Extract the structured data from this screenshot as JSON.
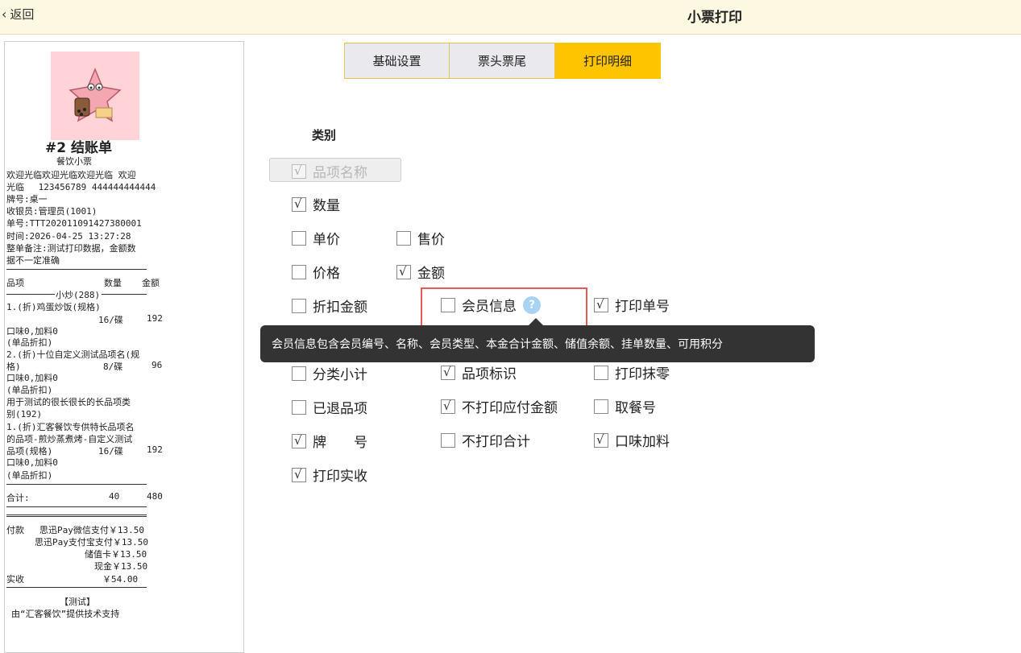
{
  "header": {
    "back_label": "返回",
    "title": "小票打印"
  },
  "tabs": [
    {
      "label": "基础设置",
      "active": false
    },
    {
      "label": "票头票尾",
      "active": false
    },
    {
      "label": "打印明细",
      "active": true
    }
  ],
  "category_label": "类别",
  "options": {
    "item_name": {
      "label": "品项名称",
      "checked": true,
      "disabled": true
    },
    "quantity": {
      "label": "数量",
      "checked": true
    },
    "unit_price": {
      "label": "单价",
      "checked": false
    },
    "sale_price": {
      "label": "售价",
      "checked": false
    },
    "price": {
      "label": "价格",
      "checked": false
    },
    "amount": {
      "label": "金额",
      "checked": true
    },
    "discount_amount": {
      "label": "折扣金额",
      "checked": false
    },
    "member_info": {
      "label": "会员信息",
      "checked": false
    },
    "print_order_no": {
      "label": "打印单号",
      "checked": true
    },
    "category_subtotal": {
      "label": "分类小计",
      "checked": false
    },
    "item_mark": {
      "label": "品项标识",
      "checked": true
    },
    "print_rounding": {
      "label": "打印抹零",
      "checked": false
    },
    "returned_items": {
      "label": "已退品项",
      "checked": false
    },
    "no_payable_amount": {
      "label": "不打印应付金额",
      "checked": true
    },
    "pickup_no": {
      "label": "取餐号",
      "checked": false
    },
    "table_no": {
      "label": "牌　　号",
      "checked": true
    },
    "no_total": {
      "label": "不打印合计",
      "checked": false
    },
    "flavor_addon": {
      "label": "口味加料",
      "checked": true
    },
    "print_received": {
      "label": "打印实收",
      "checked": true
    }
  },
  "tooltip": "会员信息包含会员编号、名称、会员类型、本金合计金额、储值余额、挂单数量、可用积分",
  "help_glyph": "?",
  "check_glyph": "√",
  "receipt": {
    "title": "#2 结账单",
    "subtitle": "餐饮小票",
    "welcome_1": "欢迎光临欢迎光临欢迎光临 欢迎",
    "welcome_2": "光临　 123456789 444444444444",
    "table": "牌号:桌一",
    "cashier": "收银员:管理员(1001)",
    "order_no": "单号:TTT202011091427380001",
    "time": "时间:2026-04-25 13:27:28",
    "note_1": "整单备注:测试打印数据，金额数",
    "note_2": "据不一定准确",
    "col_item": "品项",
    "col_qty": "数量",
    "col_amount": "金额",
    "group_title": "小炒(288)",
    "item1_name": "1.(折)鸡蛋炒饭(规格)",
    "item1_qty": "16/碟",
    "item1_amount": "192",
    "item1_flavor": "口味0,加料0",
    "item1_discount": "(单品折扣)",
    "item2_name_1": "2.(折)十位自定义测试品项名(规",
    "item2_name_2": "格)",
    "item2_qty": "8/碟",
    "item2_amount": "96",
    "item2_flavor": "口味0,加料0",
    "item2_discount": "(单品折扣)",
    "group2_title_1": "用于测试的很长很长的长品项类",
    "group2_title_2": "别(192)",
    "item3_name_1": "1.(折)汇客餐饮专供特长品项名",
    "item3_name_2": "的品项-煎炒蒸煮烤-自定义测试",
    "item3_name_3": "品项(规格)",
    "item3_qty": "16/碟",
    "item3_amount": "192",
    "item3_flavor": "口味0,加料0",
    "item3_discount": "(单品折扣)",
    "total_label": "合计:",
    "total_qty": "40",
    "total_amount": "480",
    "pay_label": "付款",
    "pay_1": "思迅Pay微信支付￥13.50",
    "pay_2": "思迅Pay支付宝支付￥13.50",
    "pay_3": "储值卡￥13.50",
    "pay_4": "现金￥13.50",
    "received_label": "实收",
    "received_amount": "￥54.00",
    "footer_1": "【测试】",
    "footer_2": "由“汇客餐饮”提供技术支持"
  }
}
